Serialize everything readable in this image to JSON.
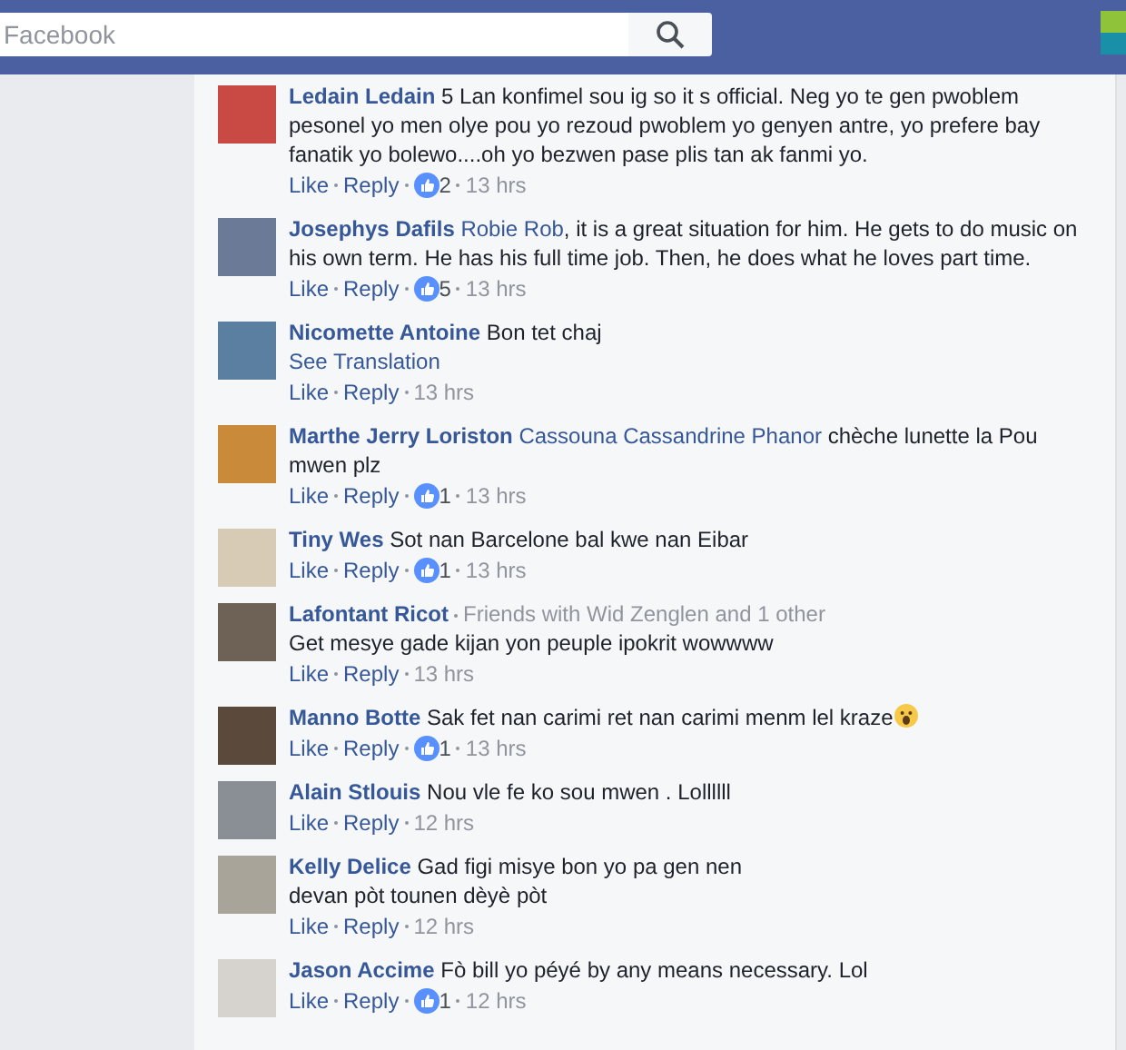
{
  "search": {
    "placeholder": "Facebook"
  },
  "comments": [
    {
      "name": "Ledain Ledain",
      "text": "5 Lan konfimel sou ig so it s official. Neg yo te gen pwoblem pesonel yo men olye pou yo rezoud pwoblem yo genyen antre, yo prefere bay fanatik yo bolewo....oh yo bezwen pase plis tan ak fanmi yo.",
      "like": "Like",
      "reply": "Reply",
      "likes": "2",
      "time": "13 hrs"
    },
    {
      "name": "Josephys Dafils",
      "mention": "Robie Rob",
      "text": ", it is a great situation for him. He gets to do music on his own term. He has his full time job. Then, he does what he loves part time.",
      "like": "Like",
      "reply": "Reply",
      "likes": "5",
      "time": "13 hrs"
    },
    {
      "name": "Nicomette Antoine",
      "text": "Bon tet chaj",
      "see_translation": "See Translation",
      "like": "Like",
      "reply": "Reply",
      "time": "13 hrs"
    },
    {
      "name": "Marthe Jerry Loriston",
      "mention": "Cassouna Cassandrine Phanor",
      "text": " chèche lunette la Pou mwen plz",
      "like": "Like",
      "reply": "Reply",
      "likes": "1",
      "time": "13 hrs"
    },
    {
      "name": "Tiny Wes",
      "text": "Sot nan Barcelone bal kwe nan Eibar",
      "like": "Like",
      "reply": "Reply",
      "likes": "1",
      "time": "13 hrs"
    },
    {
      "name": "Lafontant Ricot",
      "friends_note": "Friends with Wid Zenglen and 1 other",
      "text": "Get mesye gade kijan yon peuple ipokrit wowwww",
      "like": "Like",
      "reply": "Reply",
      "time": "13 hrs"
    },
    {
      "name": "Manno Botte",
      "text": "Sak fet nan carimi ret nan carimi menm lel kraze",
      "trailing_emoji": true,
      "like": "Like",
      "reply": "Reply",
      "likes": "1",
      "time": "13 hrs"
    },
    {
      "name": "Alain Stlouis",
      "text": "Nou vle fe ko sou mwen . Lollllll",
      "like": "Like",
      "reply": "Reply",
      "time": "12 hrs"
    },
    {
      "name": "Kelly Delice",
      "text": "Gad figi misye bon yo pa gen nen\ndevan pòt tounen dèyè pòt",
      "like": "Like",
      "reply": "Reply",
      "time": "12 hrs"
    },
    {
      "name": "Jason Accime",
      "text": "Fò bill yo péyé by any means necessary. Lol",
      "like": "Like",
      "reply": "Reply",
      "likes": "1",
      "time": "12 hrs"
    }
  ]
}
